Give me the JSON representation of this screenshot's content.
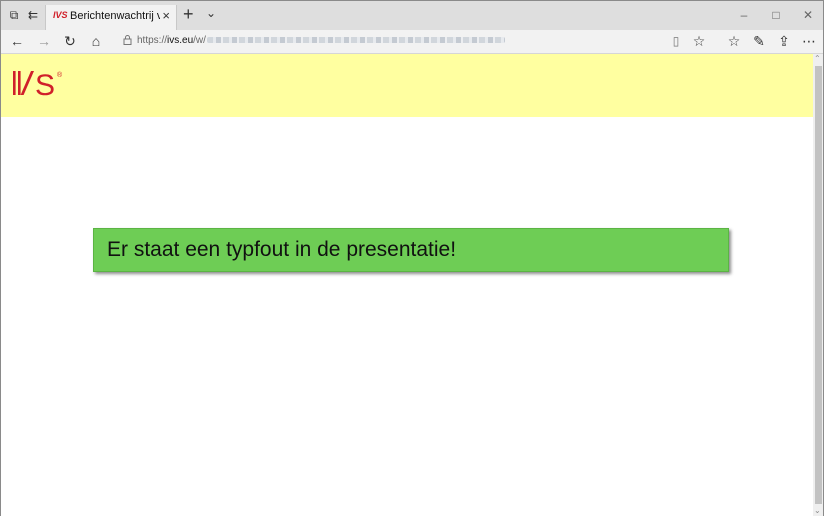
{
  "browser": {
    "tab": {
      "favicon_text": "IVS",
      "title": "Berichtenwachtrij voor I",
      "close_icon": "×"
    },
    "new_tab_icon": "+",
    "tab_list_icon": "⌄",
    "window_controls": {
      "minimize": "–",
      "maximize": "□",
      "close": "✕"
    },
    "nav": {
      "back": "←",
      "forward": "→",
      "refresh": "↻",
      "home": "⌂",
      "lock": "🔒"
    },
    "address": {
      "scheme": "https://",
      "host": "ivs.eu",
      "path": "/w/"
    },
    "toolbar_icons": {
      "reading_view": "▯",
      "favorite": "☆",
      "favorites_hub": "☆",
      "notes": "✎",
      "share": "⇪",
      "more": "⋯"
    }
  },
  "page": {
    "banner_color": "#ffffa0",
    "logo": {
      "text": "IVS",
      "mark": "®",
      "color": "#d0202a"
    },
    "message": {
      "text": "Er staat een typfout in de presentatie!",
      "background": "#6ecd55"
    }
  }
}
